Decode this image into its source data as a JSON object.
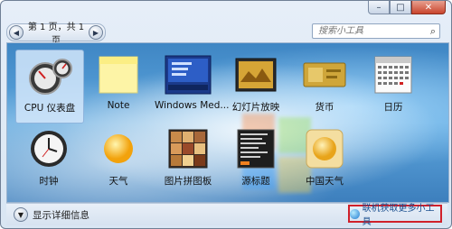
{
  "pager": {
    "text": "第 1 页，共 1 页",
    "prev": "◀",
    "next": "▶"
  },
  "search": {
    "placeholder": "搜索小工具",
    "icon": "⌕"
  },
  "caption": {
    "minimize": "–",
    "maximize": "□",
    "close": "✕"
  },
  "gadgets": [
    {
      "label": "CPU 仪表盘",
      "icon": "cpu-meter-icon",
      "selected": true
    },
    {
      "label": "Note",
      "icon": "sticky-note-icon"
    },
    {
      "label": "Windows Med...",
      "icon": "media-center-icon"
    },
    {
      "label": "幻灯片放映",
      "icon": "slideshow-icon"
    },
    {
      "label": "货币",
      "icon": "currency-icon"
    },
    {
      "label": "日历",
      "icon": "calendar-icon"
    },
    {
      "label": "时钟",
      "icon": "clock-icon"
    },
    {
      "label": "天气",
      "icon": "weather-icon"
    },
    {
      "label": "图片拼图板",
      "icon": "puzzle-icon"
    },
    {
      "label": "源标题",
      "icon": "feed-headlines-icon"
    },
    {
      "label": "中国天气",
      "icon": "china-weather-icon"
    }
  ],
  "footer": {
    "details": "显示详细信息",
    "get_more": "联机获取更多小工具"
  }
}
